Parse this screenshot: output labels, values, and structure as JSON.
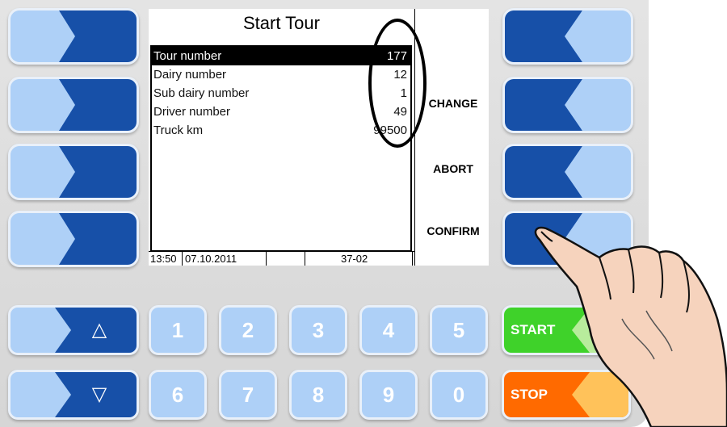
{
  "screen": {
    "title": "Start Tour",
    "rows": [
      {
        "label": "Tour number",
        "value": "177"
      },
      {
        "label": "Dairy number",
        "value": "12"
      },
      {
        "label": "Sub dairy number",
        "value": "1"
      },
      {
        "label": "Driver number",
        "value": "49"
      },
      {
        "label": "Truck km",
        "value": "99500"
      }
    ],
    "status": {
      "time": "13:50",
      "date": "07.10.2011",
      "code": "37-02"
    },
    "menu": {
      "change": "CHANGE",
      "abort": "ABORT",
      "confirm": "CONFIRM"
    }
  },
  "keypad": {
    "up": "△",
    "down": "▽",
    "digits_top": [
      "1",
      "2",
      "3",
      "4",
      "5"
    ],
    "digits_bottom": [
      "6",
      "7",
      "8",
      "9",
      "0"
    ],
    "start": "START",
    "stop": "STOP"
  },
  "colors": {
    "key_dark": "#1750a8",
    "key_light": "#aed0f7",
    "start_green": "#3fd22a",
    "stop_orange": "#ff6a00"
  }
}
